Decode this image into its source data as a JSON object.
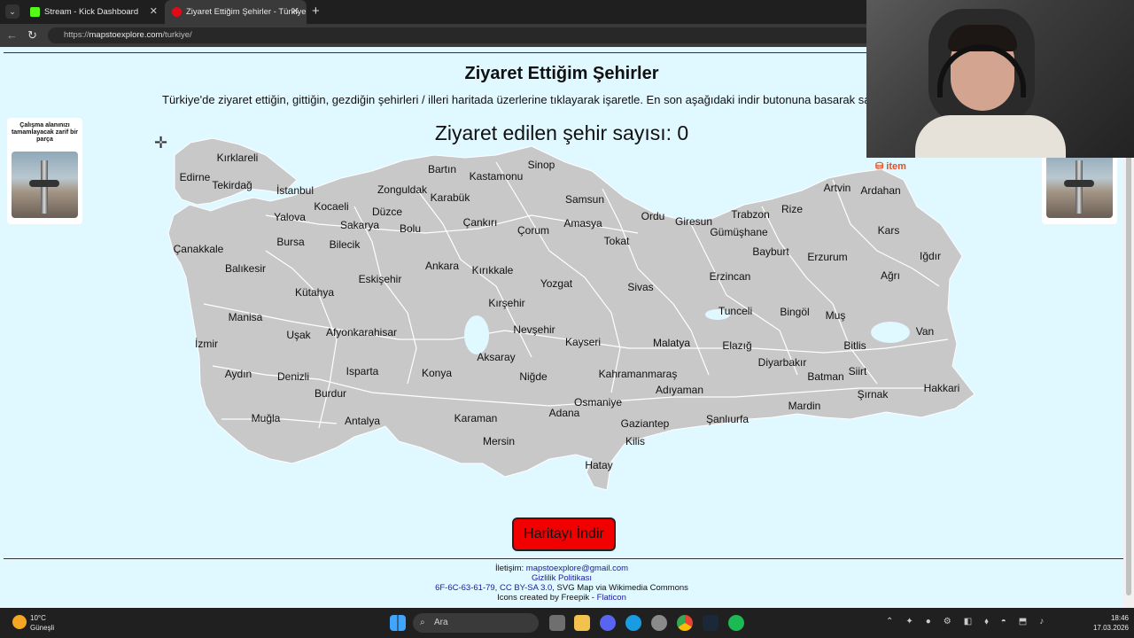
{
  "browser": {
    "tabs": [
      {
        "title": "Stream - Kick Dashboard",
        "icon": "kick-icon",
        "active": false
      },
      {
        "title": "Ziyaret Ettiğim Şehirler - Türkiye",
        "icon": "turkey-flag-icon",
        "active": true
      }
    ],
    "url_scheme": "https://",
    "url_host": "mapstoexplore.com",
    "url_path": "/turkiye/"
  },
  "page": {
    "title": "Ziyaret Ettiğim Şehirler",
    "subtitle": "Türkiye'de ziyaret ettiğin, gittiğin, gezdiğin şehirleri / illeri haritada üzerlerine tıklayarak işaretle. En son aşağıdaki indir butonuna basarak san",
    "counter_label": "Ziyaret edilen şehir sayısı: 0",
    "visited_count": 0,
    "download_button": "Haritayı İndir",
    "ad_left_text": "Çalışma alanınızı tamamlayacak zarif bir parça",
    "ad_brand": "item"
  },
  "cities": [
    "Kırklareli",
    "Edirne",
    "Tekirdağ",
    "İstanbul",
    "Bartın",
    "Sinop",
    "Kastamonu",
    "Zonguldak",
    "Karabük",
    "Samsun",
    "Artvin",
    "Ardahan",
    "Kocaeli",
    "Yalova",
    "Düzce",
    "Sakarya",
    "Bolu",
    "Çankırı",
    "Çorum",
    "Amasya",
    "Ordu",
    "Giresun",
    "Trabzon",
    "Rize",
    "Gümüşhane",
    "Bursa",
    "Bilecik",
    "Tokat",
    "Kars",
    "Çanakkale",
    "Bayburt",
    "Erzurum",
    "Iğdır",
    "Balıkesir",
    "Ankara",
    "Kırıkkale",
    "Eskişehir",
    "Yozgat",
    "Sivas",
    "Erzincan",
    "Ağrı",
    "Kütahya",
    "Kırşehir",
    "Manisa",
    "Tunceli",
    "Bingöl",
    "Muş",
    "Uşak",
    "Afyonkarahisar",
    "Nevşehir",
    "Van",
    "İzmir",
    "Kayseri",
    "Malatya",
    "Elazığ",
    "Bitlis",
    "Aksaray",
    "Diyarbakır",
    "Aydın",
    "Denizli",
    "Isparta",
    "Konya",
    "Niğde",
    "Kahramanmaraş",
    "Siirt",
    "Batman",
    "Hakkari",
    "Adıyaman",
    "Burdur",
    "Şırnak",
    "Osmaniye",
    "Mardin",
    "Adana",
    "Muğla",
    "Karaman",
    "Şanlıurfa",
    "Antalya",
    "Gaziantep",
    "Mersin",
    "Kilis",
    "Hatay"
  ],
  "footer": {
    "contact_label": "İletişim: ",
    "contact_email": "mapstoexplore@gmail.com",
    "privacy": "Gizlilik Politikası",
    "credit_link": "6F-6C-63-61-79, CC BY-SA 3.0",
    "credit_rest": ", SVG Map via Wikimedia Commons",
    "icons_prefix": "Icons created by Freepik - ",
    "icons_link": "Flaticon"
  },
  "taskbar": {
    "weather_temp": "10°C",
    "weather_desc": "Güneşli",
    "search_placeholder": "Ara",
    "time": "18:46",
    "date": "17.03.2026"
  },
  "colors": {
    "page_bg": "#e0f8ff",
    "map_fill": "#c8c8c8",
    "button_bg": "#f20000"
  }
}
